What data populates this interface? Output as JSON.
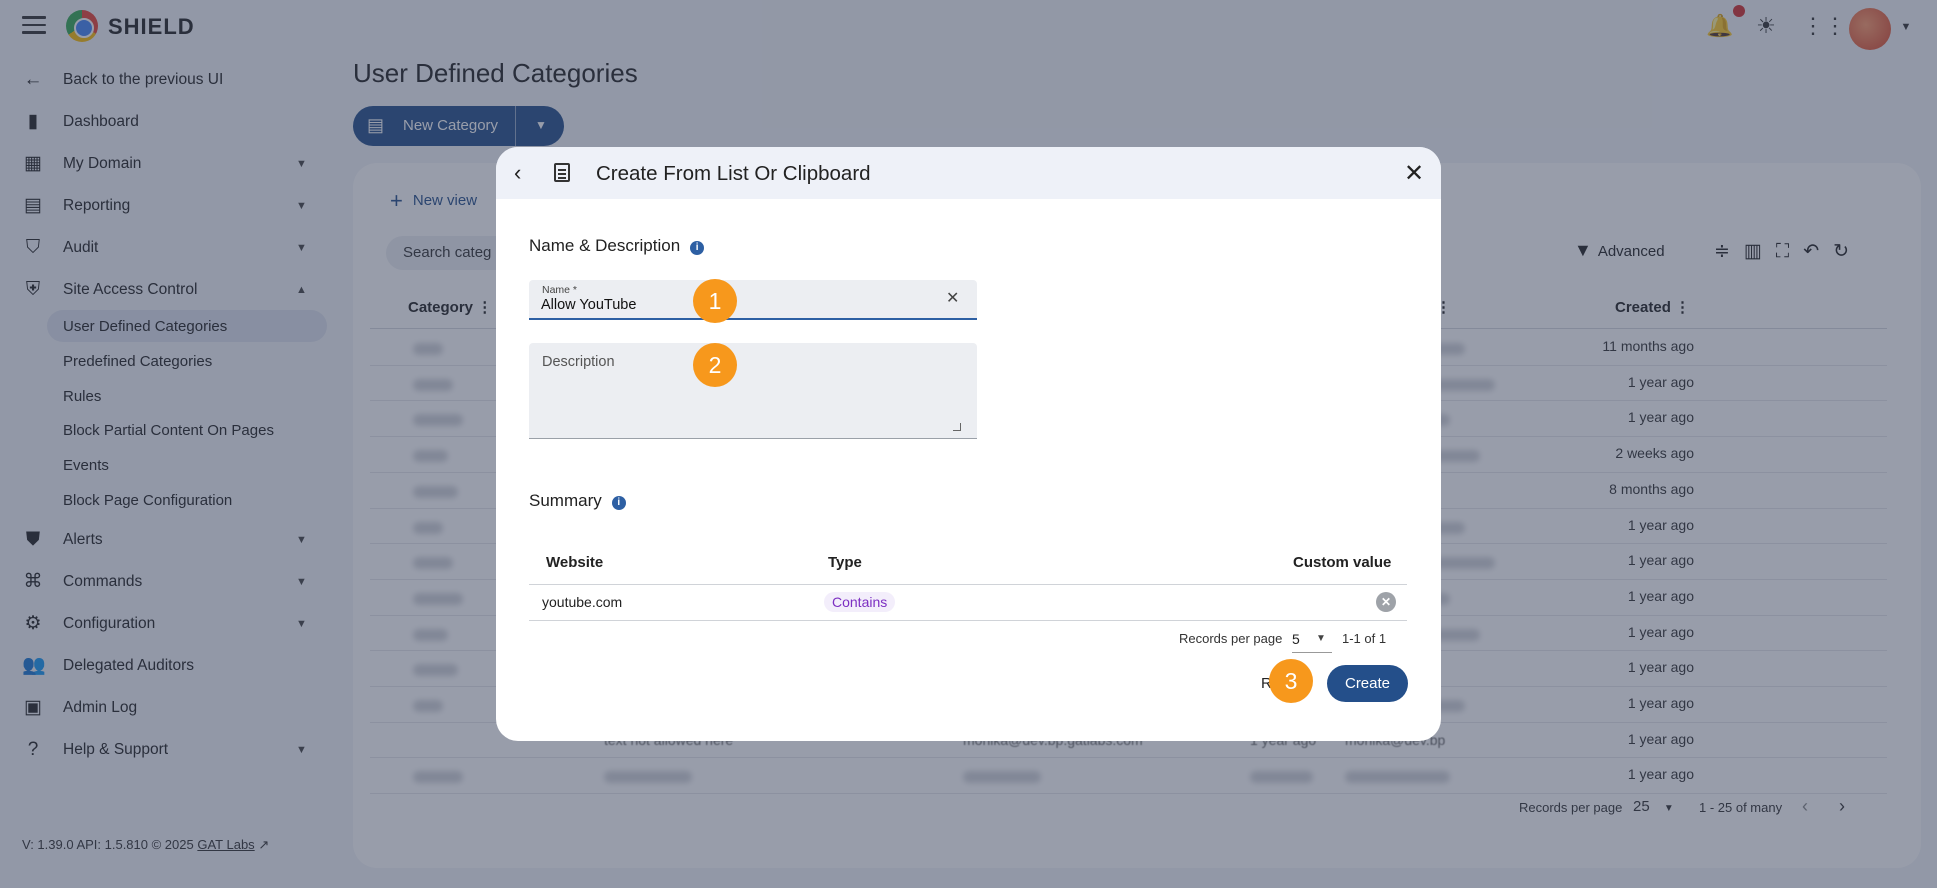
{
  "app": {
    "brand": "SHIELD"
  },
  "sidebar": {
    "back": "Back to the previous UI",
    "items": [
      {
        "label": "Dashboard",
        "icon": "bar-chart-icon"
      },
      {
        "label": "My Domain",
        "icon": "domain-icon"
      },
      {
        "label": "Reporting",
        "icon": "clipboard-icon"
      },
      {
        "label": "Audit",
        "icon": "audit-shield-icon"
      },
      {
        "label": "Site Access Control",
        "icon": "shield-check-icon"
      },
      {
        "label": "Alerts",
        "icon": "alert-shield-icon"
      },
      {
        "label": "Commands",
        "icon": "commands-icon"
      },
      {
        "label": "Configuration",
        "icon": "gear-icon"
      },
      {
        "label": "Delegated Auditors",
        "icon": "people-icon"
      },
      {
        "label": "Admin Log",
        "icon": "log-icon"
      },
      {
        "label": "Help & Support",
        "icon": "help-icon"
      }
    ],
    "sub_items": [
      "User Defined Categories",
      "Predefined Categories",
      "Rules",
      "Block Partial Content On Pages",
      "Events",
      "Block Page Configuration"
    ]
  },
  "footer": {
    "text": "V: 1.39.0   API: 1.5.810   © 2025",
    "link": "GAT Labs"
  },
  "page": {
    "title": "User Defined Categories",
    "new_category": "New Category",
    "new_view": "New view",
    "search": "Search categ",
    "advanced": "Advanced",
    "columns": {
      "category": "Category",
      "created": "Created"
    },
    "created_values": [
      "11 months ago",
      "1 year ago",
      "1 year ago",
      "2 weeks ago",
      "8 months ago",
      "1 year ago",
      "1 year ago",
      "1 year ago",
      "1 year ago",
      "1 year ago",
      "1 year ago",
      "1 year ago",
      "1 year ago"
    ],
    "bg_row_text": {
      "desc": "text not allowed here",
      "email": "monika@dev.bp.gatlabs.com",
      "age": "1 year ago",
      "email2": "monika@dev.bp"
    },
    "pager": {
      "label": "Records per page",
      "value": "25",
      "range": "1 - 25 of many"
    }
  },
  "dialog": {
    "title": "Create From List Or Clipboard",
    "section_name": "Name & Description",
    "name_label": "Name *",
    "name_value": "Allow YouTube",
    "description_placeholder": "Description",
    "section_summary": "Summary",
    "table": {
      "headers": {
        "website": "Website",
        "type": "Type",
        "custom": "Custom value"
      },
      "rows": [
        {
          "website": "youtube.com",
          "type": "Contains"
        }
      ]
    },
    "records_per_page": "Records per page",
    "rpp_value": "5",
    "range": "1-1 of 1",
    "reset": "R",
    "create": "Create"
  },
  "steps": [
    "1",
    "2",
    "3"
  ]
}
